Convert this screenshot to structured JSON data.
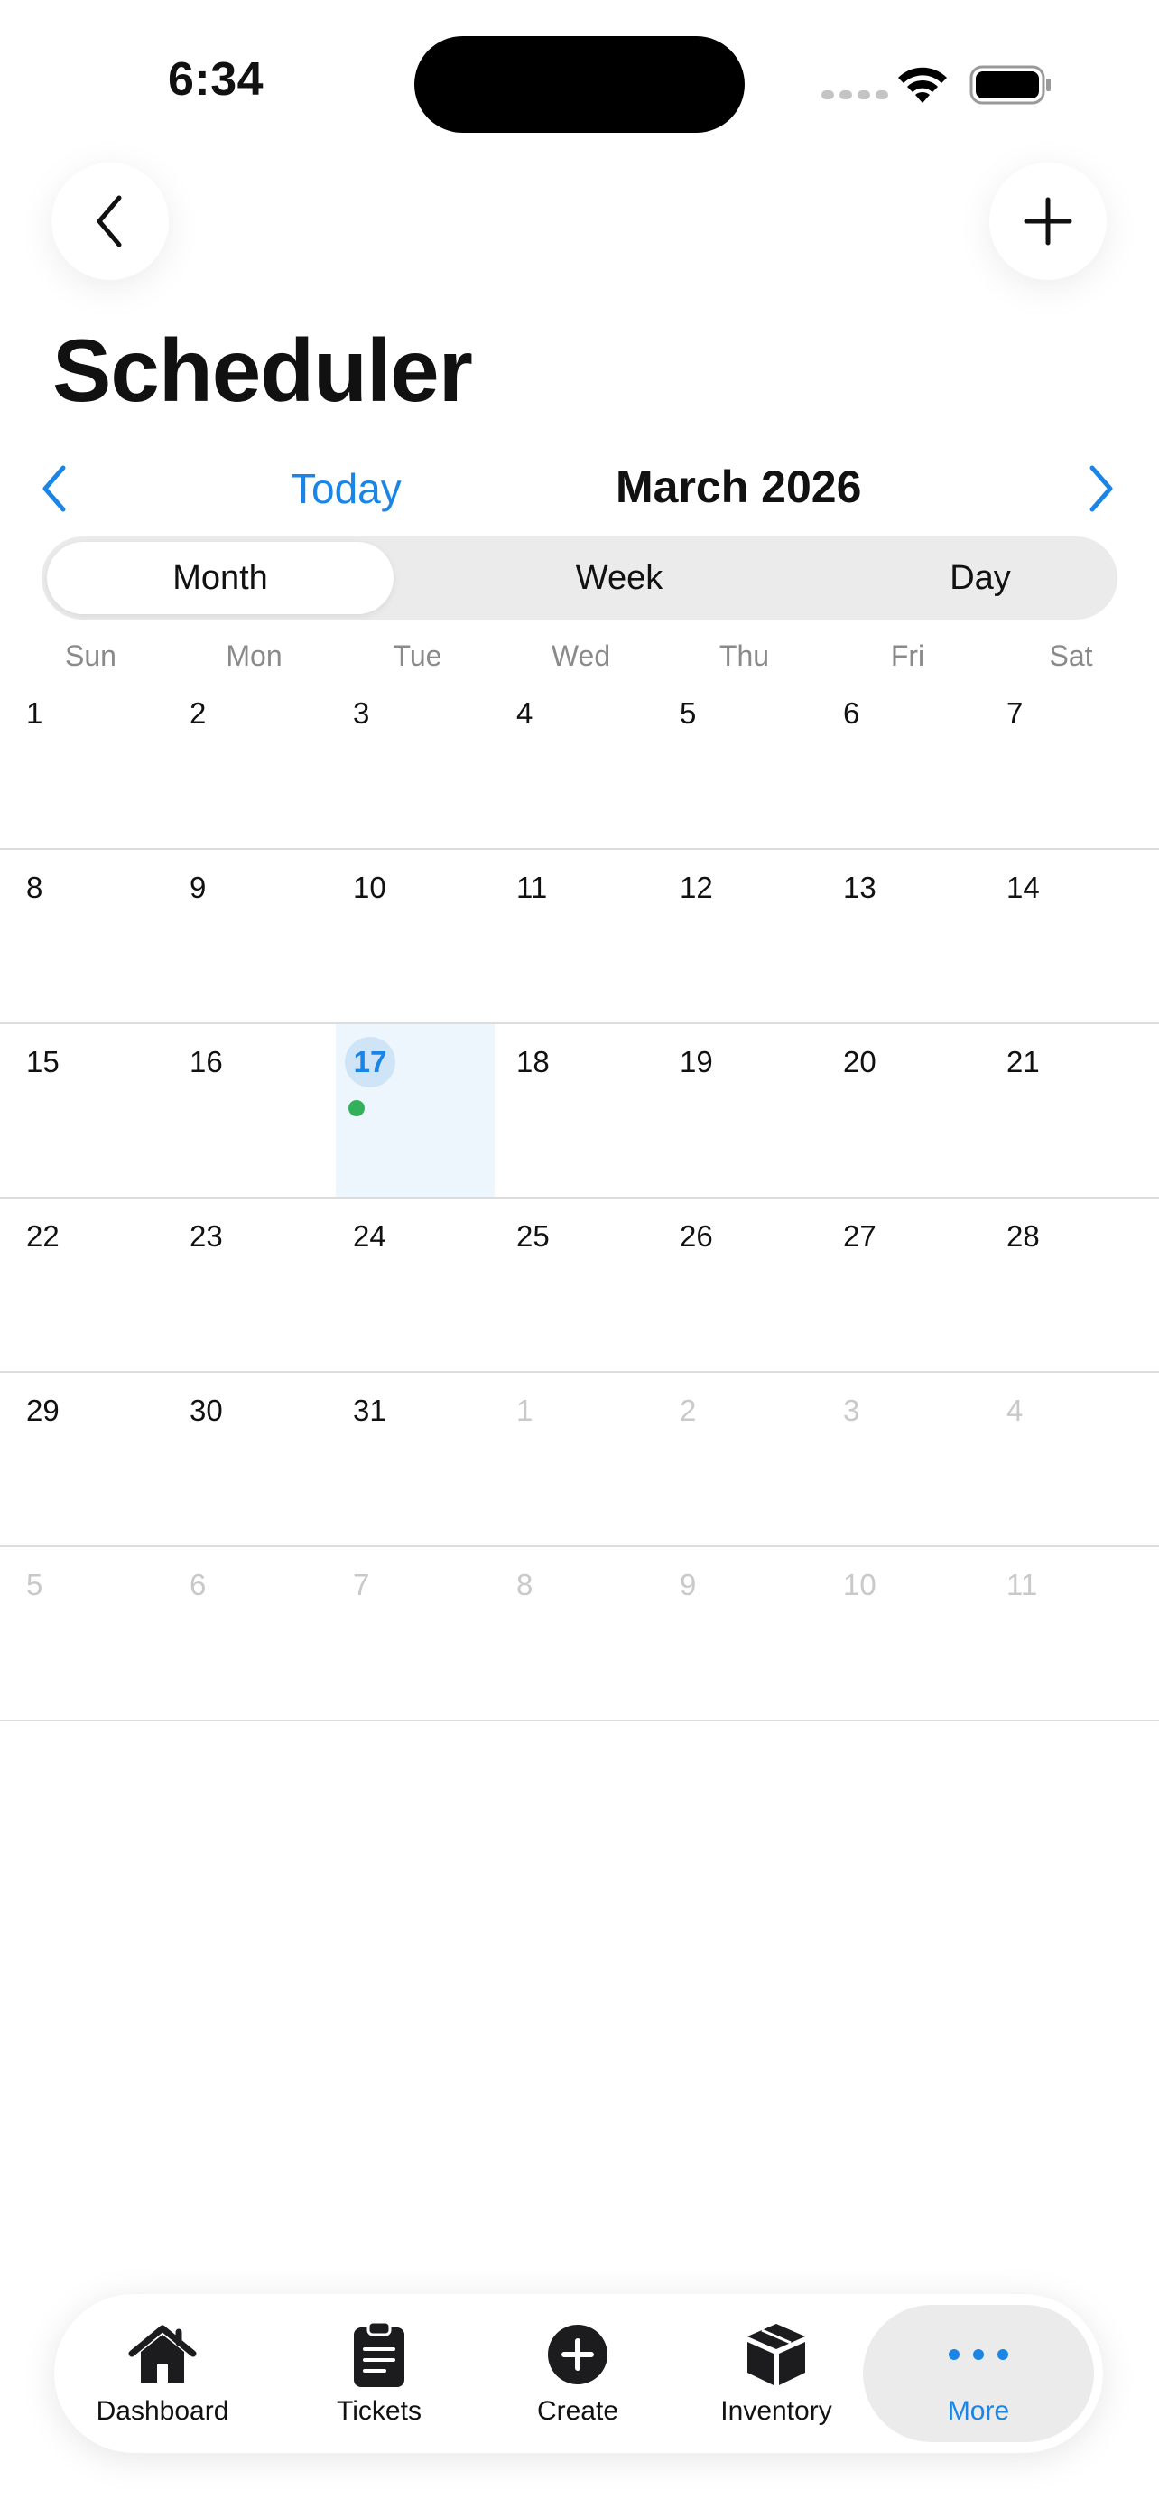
{
  "status_bar": {
    "time": "6:34"
  },
  "header": {
    "title": "Scheduler",
    "back_icon": "chevron-left-icon",
    "add_icon": "plus-icon"
  },
  "month_nav": {
    "today_label": "Today",
    "month_label": "March 2026"
  },
  "view_modes": {
    "month": "Month",
    "week": "Week",
    "day": "Day",
    "selected": "Month"
  },
  "weekdays": [
    "Sun",
    "Mon",
    "Tue",
    "Wed",
    "Thu",
    "Fri",
    "Sat"
  ],
  "weeks": [
    [
      "1",
      "2",
      "3",
      "4",
      "5",
      "6",
      "7"
    ],
    [
      "8",
      "9",
      "10",
      "11",
      "12",
      "13",
      "14"
    ],
    [
      "15",
      "16",
      "17",
      "18",
      "19",
      "20",
      "21"
    ],
    [
      "22",
      "23",
      "24",
      "25",
      "26",
      "27",
      "28"
    ],
    [
      "29",
      "30",
      "31",
      "1",
      "2",
      "3",
      "4"
    ],
    [
      "5",
      "6",
      "7",
      "8",
      "9",
      "10",
      "11"
    ]
  ],
  "today": "17",
  "colors": {
    "accent": "#1a85e6",
    "event": "#33b15a",
    "today_bg": "#eef6fd"
  },
  "tabbar": {
    "dashboard": "Dashboard",
    "tickets": "Tickets",
    "create": "Create",
    "inventory": "Inventory",
    "more": "More",
    "selected": "More"
  }
}
